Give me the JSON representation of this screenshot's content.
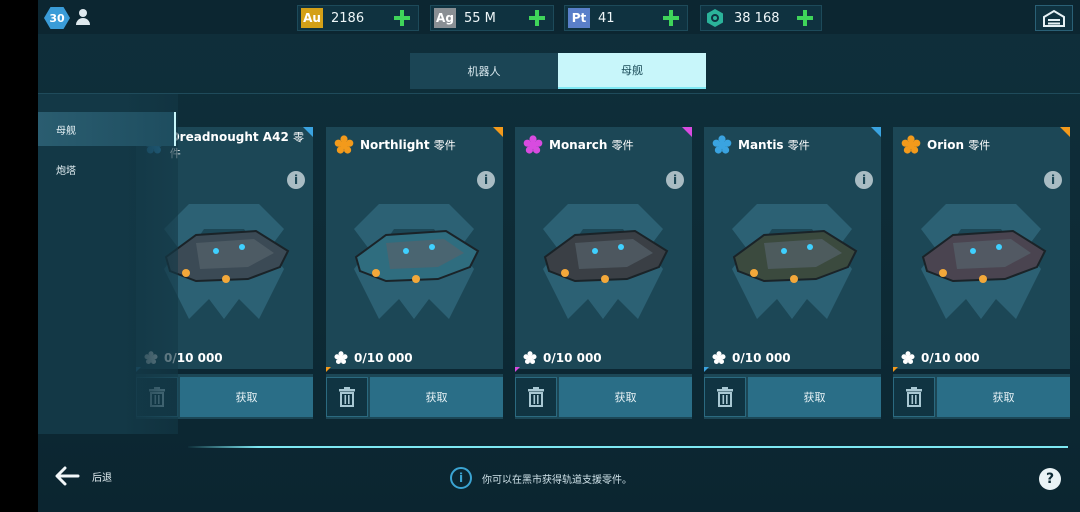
{
  "player": {
    "level": "30"
  },
  "resources": [
    {
      "tag": "Au",
      "value": "2186",
      "color": "#d4a017"
    },
    {
      "tag": "Ag",
      "value": "55 M",
      "color": "#8a8f94"
    },
    {
      "tag": "Pt",
      "value": "41",
      "color": "#5a7fc9"
    },
    {
      "tag": "",
      "value": "38 168",
      "color": "#2bb39a"
    }
  ],
  "tabs": [
    {
      "label": "机器人",
      "active": false
    },
    {
      "label": "母舰",
      "active": true
    }
  ],
  "side_menu": [
    {
      "label": "母舰",
      "active": true
    },
    {
      "label": "炮塔",
      "active": false
    }
  ],
  "cards": [
    {
      "name": "Dreadnought A42",
      "suffix": "零件",
      "progress": "0/10 000",
      "action": "获取",
      "color": "#3aa3e0",
      "ship_color": "#3b4a55"
    },
    {
      "name": "Northlight",
      "suffix": "零件",
      "progress": "0/10 000",
      "action": "获取",
      "color": "#f39a1b",
      "ship_color": "#2f6d7f"
    },
    {
      "name": "Monarch",
      "suffix": "零件",
      "progress": "0/10 000",
      "action": "获取",
      "color": "#d84be0",
      "ship_color": "#3a3f45"
    },
    {
      "name": "Mantis",
      "suffix": "零件",
      "progress": "0/10 000",
      "action": "获取",
      "color": "#3aa3e0",
      "ship_color": "#3b4a3e"
    },
    {
      "name": "Orion",
      "suffix": "零件",
      "progress": "0/10 000",
      "action": "获取",
      "color": "#f39a1b",
      "ship_color": "#4a4450"
    }
  ],
  "footer": {
    "back_label": "后退",
    "hint": "你可以在黑市获得轨道支援零件。"
  },
  "accent": "#7ee8f3"
}
